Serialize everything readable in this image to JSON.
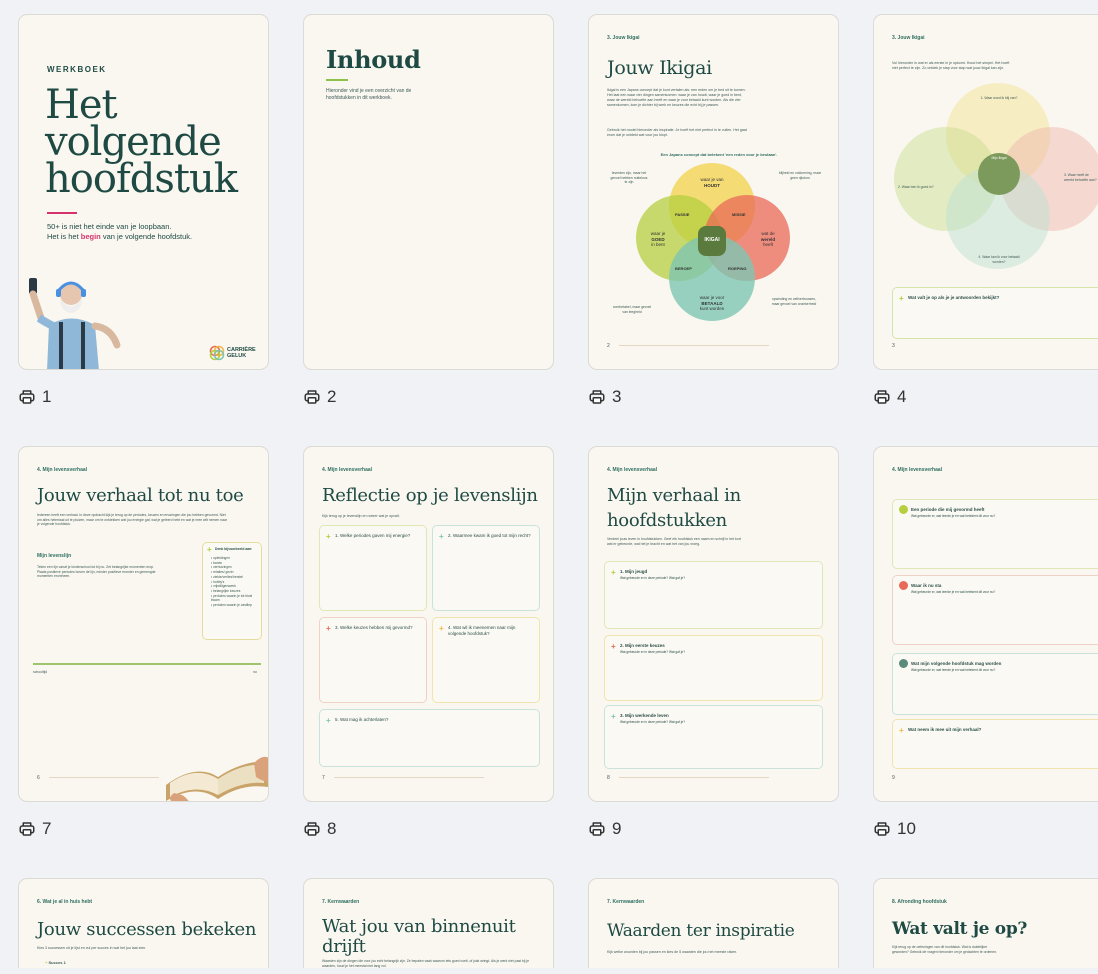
{
  "pages": [
    {
      "number": "1",
      "label": "WERKBOEK",
      "title": "Het volgende hoofdstuk",
      "subtitle_1": "50+ is niet het einde van je loopbaan.",
      "subtitle_2_pre": "Het is het ",
      "subtitle_2_em": "begin",
      "subtitle_2_post": " van je volgende hoofdstuk.",
      "logo_top": "CARRIÈRE",
      "logo_bottom": "GELUK"
    },
    {
      "number": "2",
      "title": "Inhoud",
      "intro": "Hieronder vind je een overzicht van de hoofdstukken in dit werkboek."
    },
    {
      "number": "3",
      "section": "3. Jouw Ikigai",
      "title": "Jouw Ikigai",
      "para1": "Ikigai is een Japans concept dat je kunt vertalen als: een reden om je bed uit te komen. Het laat een waar vier dingen samenkomen: waar je van houdt, waar je goed in bent, waar de wereld behoefte aan heeft en waar je voor betaald kunt worden. Als die vier samenkomen, kom je dichter bij werk en keuzes die echt bij je passen.",
      "para2": "Gebruik het model hieronder als inspiratie. Je hoeft het niet perfect in te vullen. Het gaat erom dat je ontdekt wat voor jou klopt.",
      "caption": "Een Japans concept dat betekent 'een reden voor je bestaan'.",
      "c_love": "waar je van",
      "c_love_b": "HOUDT",
      "c_good_1": "waar je",
      "c_good_b": "GOED",
      "c_good_2": "in bent",
      "c_world_1": "wat de",
      "c_world_b": "wereld",
      "c_world_2": "heeft",
      "c_paid_1": "waar je voor",
      "c_paid_b": "BETAALD",
      "c_paid_2": "kunt worden",
      "passie": "PASSIE",
      "missie": "MISSIE",
      "beroep": "BEROEP",
      "roeping": "ROEPING",
      "center": "IKIGAI",
      "note_tl": "tevreden zijn, maar het gevoel hebben nutteloos te zijn",
      "note_tr": "blijheid en voldoening, maar geen rijkdom",
      "note_bl": "comfortabel, maar gevoel van leegheid",
      "note_br": "opwinding en zelfvertrouwen, maar gevoel van onzekerheid",
      "page_no": "2"
    },
    {
      "number": "4",
      "section": "3. Jouw Ikigai",
      "intro": "Vul hieronder in wat er als eerste in je opkomt. Houd het simpel. Het hoeft niet perfect te zijn. Zo ontdek je stap voor stap wat jouw Ikigai kan zijn.",
      "q1": "1. Waar word ik blij van?",
      "q2": "2. Waar ben ik goed in?",
      "q3": "3. Waar heeft de wereld behoefte aan?",
      "q4": "4. Waar kan ik voor betaald worden?",
      "center": "Mijn Ikigai",
      "prompt": "Wat valt je op als je je antwoorden bekijkt?",
      "page_no": "3"
    },
    {
      "number": "7",
      "section": "4. Mijn levensverhaal",
      "title": "Jouw verhaal tot nu toe",
      "intro": "Iedereen heeft een verhaal. In deze opdracht kijk je terug op de periodes, keuzes en ervaringen die jou hebben gevormd. Niet om alles helemaal uit te pluizen, maar om te ontdekken wat jou energie gaf, wat je geleerd hebt en wat je mee wilt nemen naar je volgende hoofdstuk.",
      "subhead": "Mijn levenslijn",
      "body": "Teken een lijn vanaf je kinderschool tot bij nu. Zet belangrijke momenten erop. Plaats positieve periodes boven de lijn, minder positieve eronder en gemengde momenten eromheen.",
      "tip_title": "Denk bijvoorbeeld aan:",
      "tips": [
        "opleidingen",
        "banen",
        "verhuizingen",
        "relaties/ gezin",
        "ziekte/verlies/herstel",
        "hobby's",
        "vrijwilligerswerk",
        "belangrijke keuzes",
        "periodes waarin je tot bloei kwam",
        "periodes waarin je vastliep"
      ],
      "axis_left": "schooltijd",
      "axis_right": "nu",
      "page_no": "6"
    },
    {
      "number": "8",
      "section": "4. Mijn levensverhaal",
      "title": "Reflectie op je levenslijn",
      "intro": "Kijk terug op je levenslijn en noteer wat je opvalt.",
      "q1": "1. Welke periodes gaven mij energie?",
      "q2": "2. Waarmee kwam ik goed tot mijn recht?",
      "q3": "3. Welke keuzes hebben mij gevormd?",
      "q4": "4. Wat wil ik meenemen naar mijn volgende hoofdstuk?",
      "q5": "5. Wat mag ik achterlaten?",
      "page_no": "7"
    },
    {
      "number": "9",
      "section": "4. Mijn levensverhaal",
      "title": "Mijn verhaal in hoofdstukken",
      "intro": "Verdeel jouw leven in hoofdstukken. Geef elk hoofdstuk een naam en schrijf in het kort wat er gebeurde, wat het je bracht en wat het van jou vroeg.",
      "q1": "1. Mijn jeugd",
      "q2": "2. Mijn eerste keuzes",
      "q3": "3. Mijn werkende leven",
      "hint": "Wat gebeurde er in deze periode? Wat gaf je?",
      "page_no": "8"
    },
    {
      "number": "10",
      "section": "4. Mijn levensverhaal",
      "q1": "Een periode die mij gevormd heeft",
      "q2": "Waar ik nu sta",
      "q3": "Wat mijn volgende hoofdstuk mag worden",
      "q4": "Wat neem ik mee uit mijn verhaal?",
      "hint": "Wat gebeurde er, wat leerde je en wat betekent dit voor nu?",
      "page_no": "9"
    },
    {
      "section": "6. Wat je al in huis hebt",
      "title": "Jouw successen bekeken",
      "intro": "Kies 3 successen uit je lijst en vul per succes in wat het jou laat zien.",
      "item": "Succes 1"
    },
    {
      "section": "7. Kernwaarden",
      "title": "Wat jou van binnenuit drijft",
      "intro": "Waarden zijn de dingen die voor jou echt belangrijk zijn. Ze bepalen vaak waarom iets goed voelt, of juist wringt. Als je werk niet past bij je waarden, houd je het meestal niet lang vol."
    },
    {
      "section": "7. Kernwaarden",
      "title": "Waarden ter inspiratie",
      "intro": "Kijk welke woorden bij jou passen en kies de 5 waarden die jou het meeste raken."
    },
    {
      "section": "8. Afronding hoofdstuk",
      "title": "Wat valt je op?",
      "intro": "Kijk terug op de oefeningen van dit hoofdstuk. Wat is duidelijker geworden? Gebruik de vragen hieronder om je gedachten te ordenen."
    }
  ],
  "colors": {
    "green": "#1f4a44",
    "accent_green": "#8bc34a",
    "pink": "#d6336c",
    "yellow": "#f2d24a",
    "lime": "#b5cf3f",
    "red": "#e96a57",
    "teal": "#7ec6b2"
  }
}
